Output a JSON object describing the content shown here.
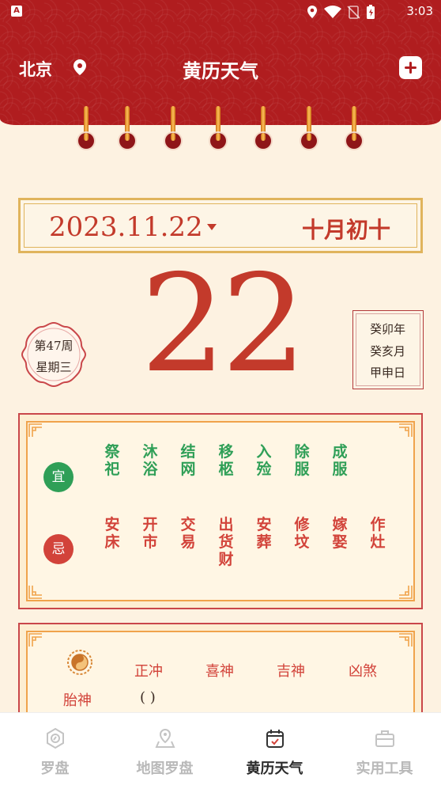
{
  "status_bar": {
    "time": "3:03",
    "app_badge": "A"
  },
  "header": {
    "city": "北京",
    "title": "黄历天气"
  },
  "date_banner": {
    "solar_date": "2023.11.22",
    "lunar_date": "十月初十"
  },
  "day": {
    "big_number": "22",
    "week_no": "第47周",
    "weekday": "星期三",
    "ganzhi": [
      "癸卯年",
      "癸亥月",
      "甲申日"
    ]
  },
  "yi_ji": {
    "yi_label": "宜",
    "ji_label": "忌",
    "yi_items": [
      "祭祀",
      "沐浴",
      "结网",
      "移柩",
      "入殓",
      "除服",
      "成服"
    ],
    "ji_items": [
      "安床",
      "开市",
      "交易",
      "出货财",
      "安葬",
      "修坟",
      "嫁娶",
      "作灶"
    ],
    "colors": {
      "yi": "#2f9f57",
      "ji": "#d2433a"
    }
  },
  "gods": {
    "headers": [
      "正冲",
      "喜神",
      "吉神",
      "凶煞"
    ],
    "taishen_label": "胎神",
    "taishen_value": "( )"
  },
  "bottom_nav": {
    "items": [
      {
        "label": "罗盘",
        "icon": "compass-icon",
        "active": false
      },
      {
        "label": "地图罗盘",
        "icon": "map-pin-icon",
        "active": false
      },
      {
        "label": "黄历天气",
        "icon": "calendar-icon",
        "active": true
      },
      {
        "label": "实用工具",
        "icon": "toolbox-icon",
        "active": false
      }
    ]
  },
  "theme": {
    "primary": "#b01d1f",
    "accent_gold": "#e0b45c",
    "text_red": "#c33a2b"
  }
}
